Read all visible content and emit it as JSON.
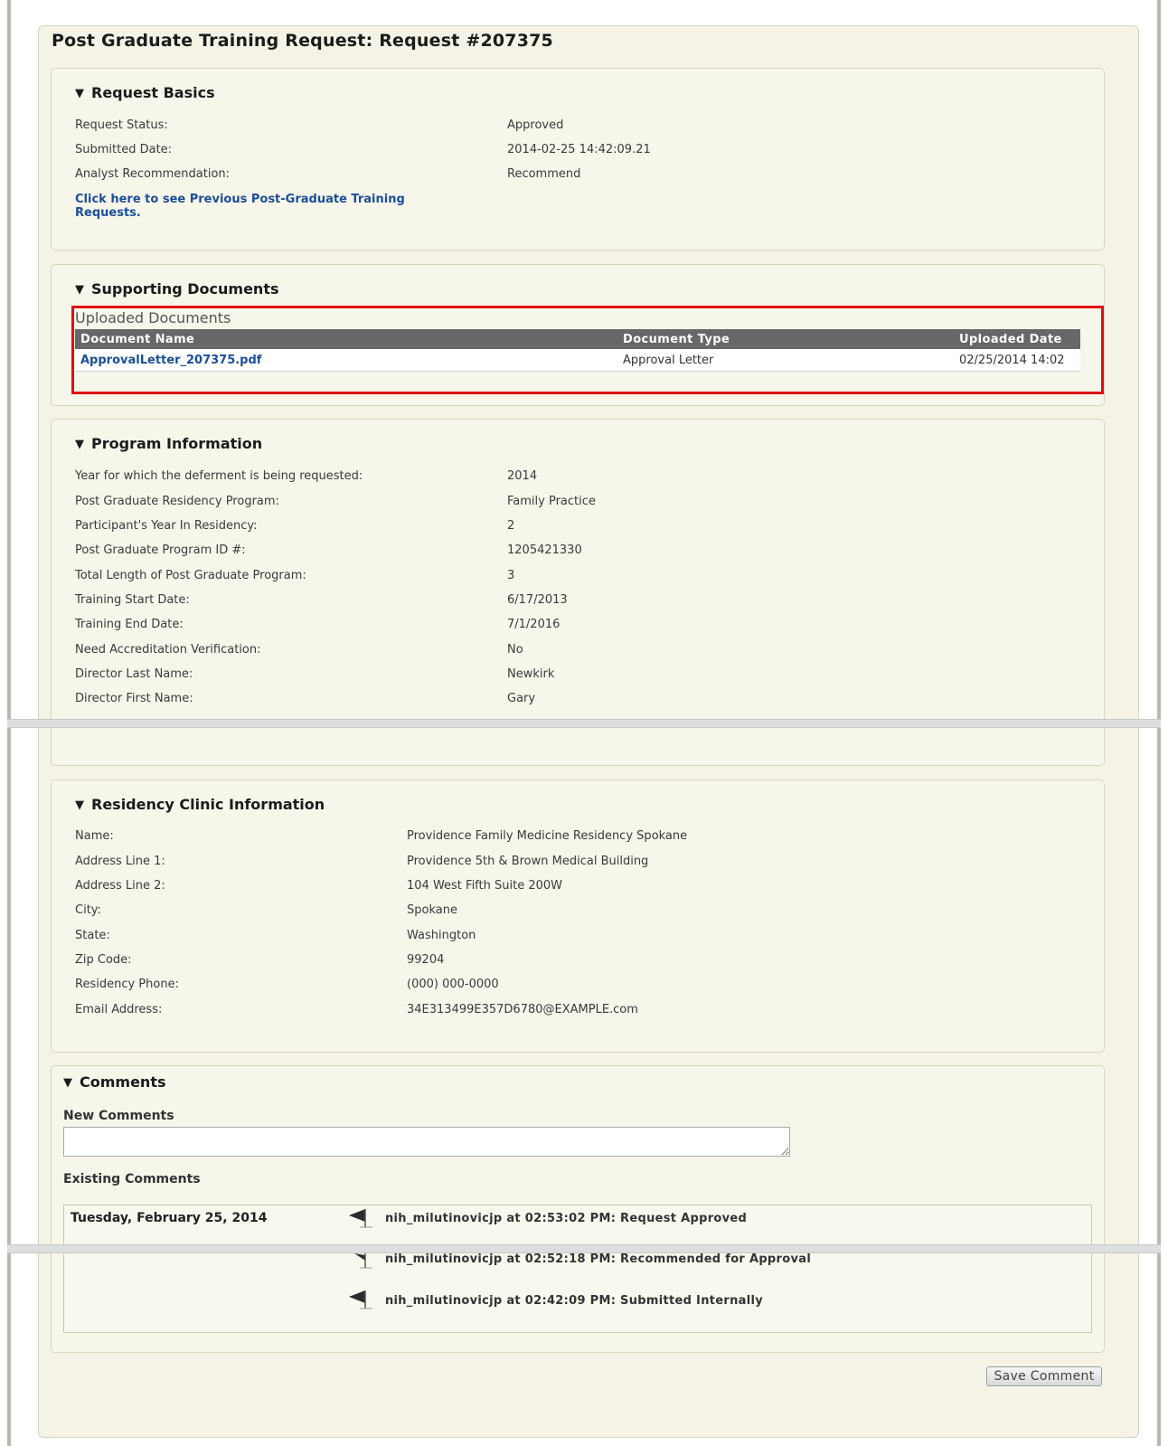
{
  "page": {
    "title": "Post Graduate Training Request: Request #207375"
  },
  "request_basics": {
    "heading": "Request Basics",
    "rows": [
      {
        "label": "Request Status:",
        "value": "Approved"
      },
      {
        "label": "Submitted Date:",
        "value": "2014-02-25 14:42:09.21"
      },
      {
        "label": "Analyst Recommendation:",
        "value": "Recommend"
      }
    ],
    "link_line1": "Click here to see Previous Post-Graduate Training",
    "link_line2": "Requests."
  },
  "supporting_documents": {
    "heading": "Supporting Documents",
    "caption": "Uploaded Documents",
    "columns": [
      "Document Name",
      "Document Type",
      "Uploaded Date"
    ],
    "rows": [
      {
        "name": "ApprovalLetter_207375.pdf",
        "type": "Approval Letter",
        "date": "02/25/2014 14:02"
      }
    ]
  },
  "program_information": {
    "heading": "Program Information",
    "rows": [
      {
        "label": "Year for which the deferment is being requested:",
        "value": "2014"
      },
      {
        "label": "Post Graduate Residency Program:",
        "value": "Family Practice"
      },
      {
        "label": "Participant's Year In Residency:",
        "value": "2"
      },
      {
        "label": "Post Graduate Program ID #:",
        "value": "1205421330"
      },
      {
        "label": "Total Length of Post Graduate Program:",
        "value": "3"
      },
      {
        "label": "Training Start Date:",
        "value": "6/17/2013"
      },
      {
        "label": "Training End Date:",
        "value": "7/1/2016"
      },
      {
        "label": "Need Accreditation Verification:",
        "value": "No"
      },
      {
        "label": "Director Last Name:",
        "value": "Newkirk"
      },
      {
        "label": "Director First Name:",
        "value": "Gary"
      }
    ]
  },
  "residency_clinic": {
    "heading": "Residency Clinic Information",
    "rows": [
      {
        "label": "Name:",
        "value": "Providence Family Medicine Residency Spokane"
      },
      {
        "label": "Address Line 1:",
        "value": "Providence 5th & Brown Medical Building"
      },
      {
        "label": "Address Line 2:",
        "value": "104 West Fifth Suite 200W"
      },
      {
        "label": "City:",
        "value": "Spokane"
      },
      {
        "label": "State:",
        "value": "Washington"
      },
      {
        "label": "Zip Code:",
        "value": "99204"
      },
      {
        "label": "Residency Phone:",
        "value": "(000) 000-0000"
      },
      {
        "label": "Email Address:",
        "value": "34E313499E357D6780@EXAMPLE.com"
      }
    ]
  },
  "comments": {
    "heading": "Comments",
    "new_label": "New Comments",
    "new_value": "",
    "existing_label": "Existing Comments",
    "date": "Tuesday, February 25, 2014",
    "entries": [
      {
        "text": "nih_milutinovicjp at 02:53:02 PM: Request Approved",
        "icon": "flag-icon"
      },
      {
        "text": "nih_milutinovicjp at 02:52:18 PM: Recommended for Approval",
        "icon": "flag-icon"
      },
      {
        "text": "nih_milutinovicjp at 02:42:09 PM: Submitted Internally",
        "icon": "flag-icon"
      }
    ],
    "save_label": "Save Comment"
  },
  "colors": {
    "link": "#1a4f9a",
    "table_header": "#676767",
    "highlight": "#e01010",
    "panel_bg": "#f4f3e6"
  }
}
